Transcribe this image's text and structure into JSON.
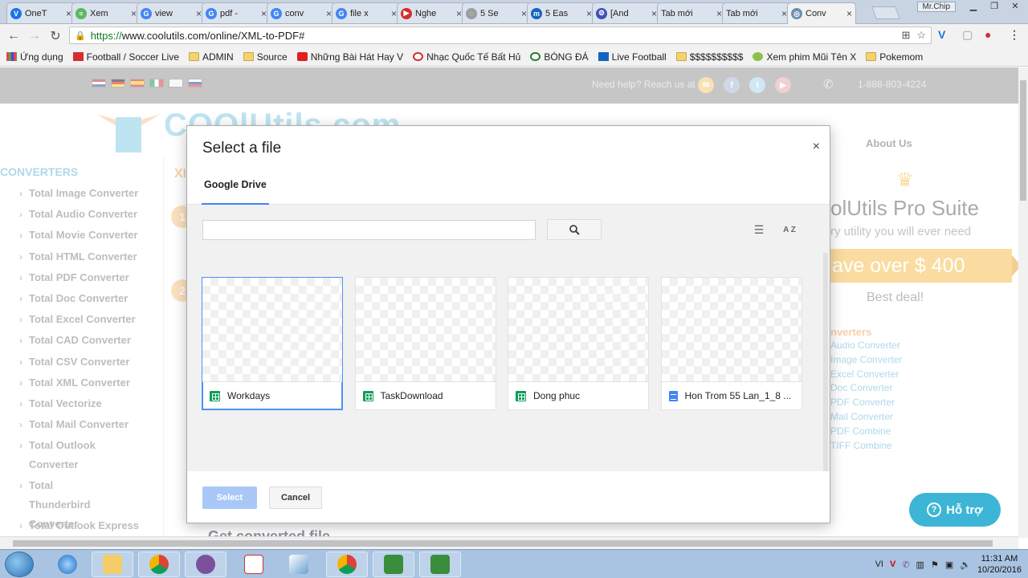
{
  "browser": {
    "tabs": [
      {
        "label": "OneT",
        "fav_color": "#1a73e8",
        "fav": "V"
      },
      {
        "label": "Xem",
        "fav_color": "#5cb85c",
        "fav": "≈"
      },
      {
        "label": "view",
        "fav_color": "#4285f4",
        "fav": "G"
      },
      {
        "label": "pdf -",
        "fav_color": "#4285f4",
        "fav": "G"
      },
      {
        "label": "conv",
        "fav_color": "#4285f4",
        "fav": "G"
      },
      {
        "label": "file x",
        "fav_color": "#4285f4",
        "fav": "G"
      },
      {
        "label": "Nghe",
        "fav_color": "#d32f2f",
        "fav": "▶"
      },
      {
        "label": "5 Se",
        "fav_color": "#9e9e9e",
        "fav": "◌"
      },
      {
        "label": "5 Eas",
        "fav_color": "#1565c0",
        "fav": "m"
      },
      {
        "label": "[And",
        "fav_color": "#3f51b5",
        "fav": "⚙"
      },
      {
        "label": "Tab mới",
        "fav_color": "",
        "fav": ""
      },
      {
        "label": "Tab mới",
        "fav_color": "",
        "fav": ""
      },
      {
        "label": "Conv",
        "fav_color": "#6a8fb5",
        "fav": "◎"
      }
    ],
    "user_label": "Mr.Chip",
    "url_prefix": "https://",
    "url_rest": "www.coolutils.com/online/XML-to-PDF#",
    "bookmarks": [
      {
        "label": "Ứng dụng",
        "kind": "apps"
      },
      {
        "label": "Football / Soccer Live",
        "kind": "red"
      },
      {
        "label": "ADMIN",
        "kind": "folder"
      },
      {
        "label": "Source",
        "kind": "folder"
      },
      {
        "label": "Những Bài Hát Hay V",
        "kind": "yt"
      },
      {
        "label": "Nhạc Quốc Tế Bất Hủ",
        "kind": "music"
      },
      {
        "label": "BÓNG ĐÁ",
        "kind": "ball"
      },
      {
        "label": "Live Football",
        "kind": "z"
      },
      {
        "label": "$$$$$$$$$$",
        "kind": "folder"
      },
      {
        "label": "Xem phim Mũi Tên X",
        "kind": "green"
      },
      {
        "label": "Pokemom",
        "kind": "folder"
      }
    ]
  },
  "site": {
    "help_text": "Need help? Reach us at",
    "phone": "1-888-803-4224",
    "logo_text": "COOlUtils.com",
    "about_us": "About Us",
    "converters_heading": "CONVERTERS",
    "sidebar_items": [
      "Total Image Converter",
      "Total Audio Converter",
      "Total Movie Converter",
      "Total HTML Converter",
      "Total PDF Converter",
      "Total Doc Converter",
      "Total Excel Converter",
      "Total CAD Converter",
      "Total CSV Converter",
      "Total XML Converter",
      "Total Vectorize",
      "Total Mail Converter",
      "Total Outlook Converter",
      "Total Thunderbird Converter",
      "Total Outlook Express"
    ],
    "step_title_partial": "XI",
    "step1": "1",
    "step2": "2",
    "get_converted": "Get converted file",
    "promo": {
      "suite": "olUtils Pro Suite",
      "tagline": "ry utility you will ever need",
      "banner": "ave over $ 400",
      "deal": "Best deal!",
      "conv_heading": "nverters",
      "conv_list": [
        "Audio Converter",
        "Image Converter",
        "Excel Converter",
        "Doc Converter",
        "PDF Converter",
        "Mail Converter",
        "PDF Combine",
        "TIFF Combine"
      ]
    },
    "support_button": "Hỗ trợ"
  },
  "dialog": {
    "title": "Select a file",
    "close_glyph": "×",
    "tab": "Google Drive",
    "search_value": "",
    "az_label": "A Z",
    "files": [
      {
        "name": "Workdays",
        "type": "sheet",
        "selected": true
      },
      {
        "name": "TaskDownload",
        "type": "sheet",
        "selected": false
      },
      {
        "name": "Dong phuc",
        "type": "sheet",
        "selected": false
      },
      {
        "name": "Hon Trom 55 Lan_1_8 ...",
        "type": "doc",
        "selected": false
      }
    ],
    "select_label": "Select",
    "cancel_label": "Cancel"
  },
  "taskbar": {
    "lang": "VI",
    "time": "11:31 AM",
    "date": "10/20/2016"
  }
}
